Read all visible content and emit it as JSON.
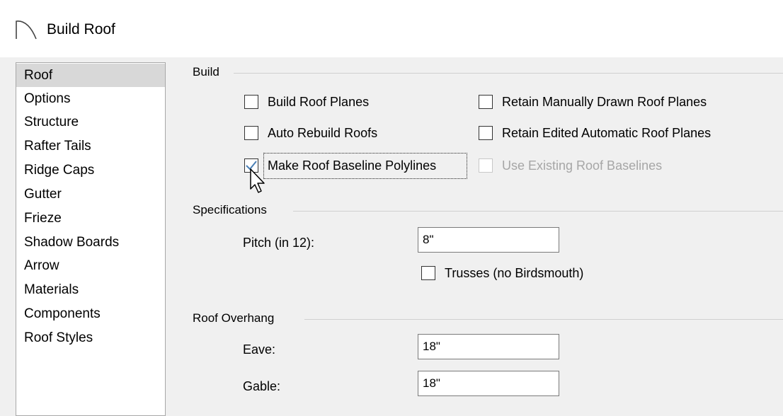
{
  "window": {
    "title": "Build Roof",
    "icon": "roof-arc-icon"
  },
  "sidebar": {
    "items": [
      {
        "label": "Roof",
        "selected": true
      },
      {
        "label": "Options"
      },
      {
        "label": "Structure"
      },
      {
        "label": "Rafter Tails"
      },
      {
        "label": "Ridge Caps"
      },
      {
        "label": "Gutter"
      },
      {
        "label": "Frieze"
      },
      {
        "label": "Shadow Boards"
      },
      {
        "label": "Arrow"
      },
      {
        "label": "Materials"
      },
      {
        "label": "Components"
      },
      {
        "label": "Roof Styles"
      }
    ]
  },
  "build": {
    "label": "Build",
    "build_roof_planes": {
      "label": "Build Roof Planes",
      "checked": false
    },
    "retain_manual": {
      "label": "Retain Manually Drawn Roof Planes",
      "checked": false
    },
    "auto_rebuild": {
      "label": "Auto Rebuild Roofs",
      "checked": false
    },
    "retain_edited": {
      "label": "Retain Edited Automatic Roof Planes",
      "checked": false
    },
    "make_baseline": {
      "label": "Make Roof Baseline Polylines",
      "checked": true
    },
    "use_existing": {
      "label": "Use Existing Roof Baselines",
      "checked": false,
      "disabled": true
    }
  },
  "specifications": {
    "label": "Specifications",
    "pitch": {
      "label": "Pitch (in 12):",
      "value": "8\""
    },
    "trusses": {
      "label": "Trusses (no Birdsmouth)",
      "checked": false
    }
  },
  "overhang": {
    "label": "Roof Overhang",
    "eave": {
      "label": "Eave:",
      "value": "18\""
    },
    "gable": {
      "label": "Gable:",
      "value": "18\""
    }
  },
  "colors": {
    "check_accent": "#4a7fb5",
    "disabled_text": "#a6a6a6"
  }
}
